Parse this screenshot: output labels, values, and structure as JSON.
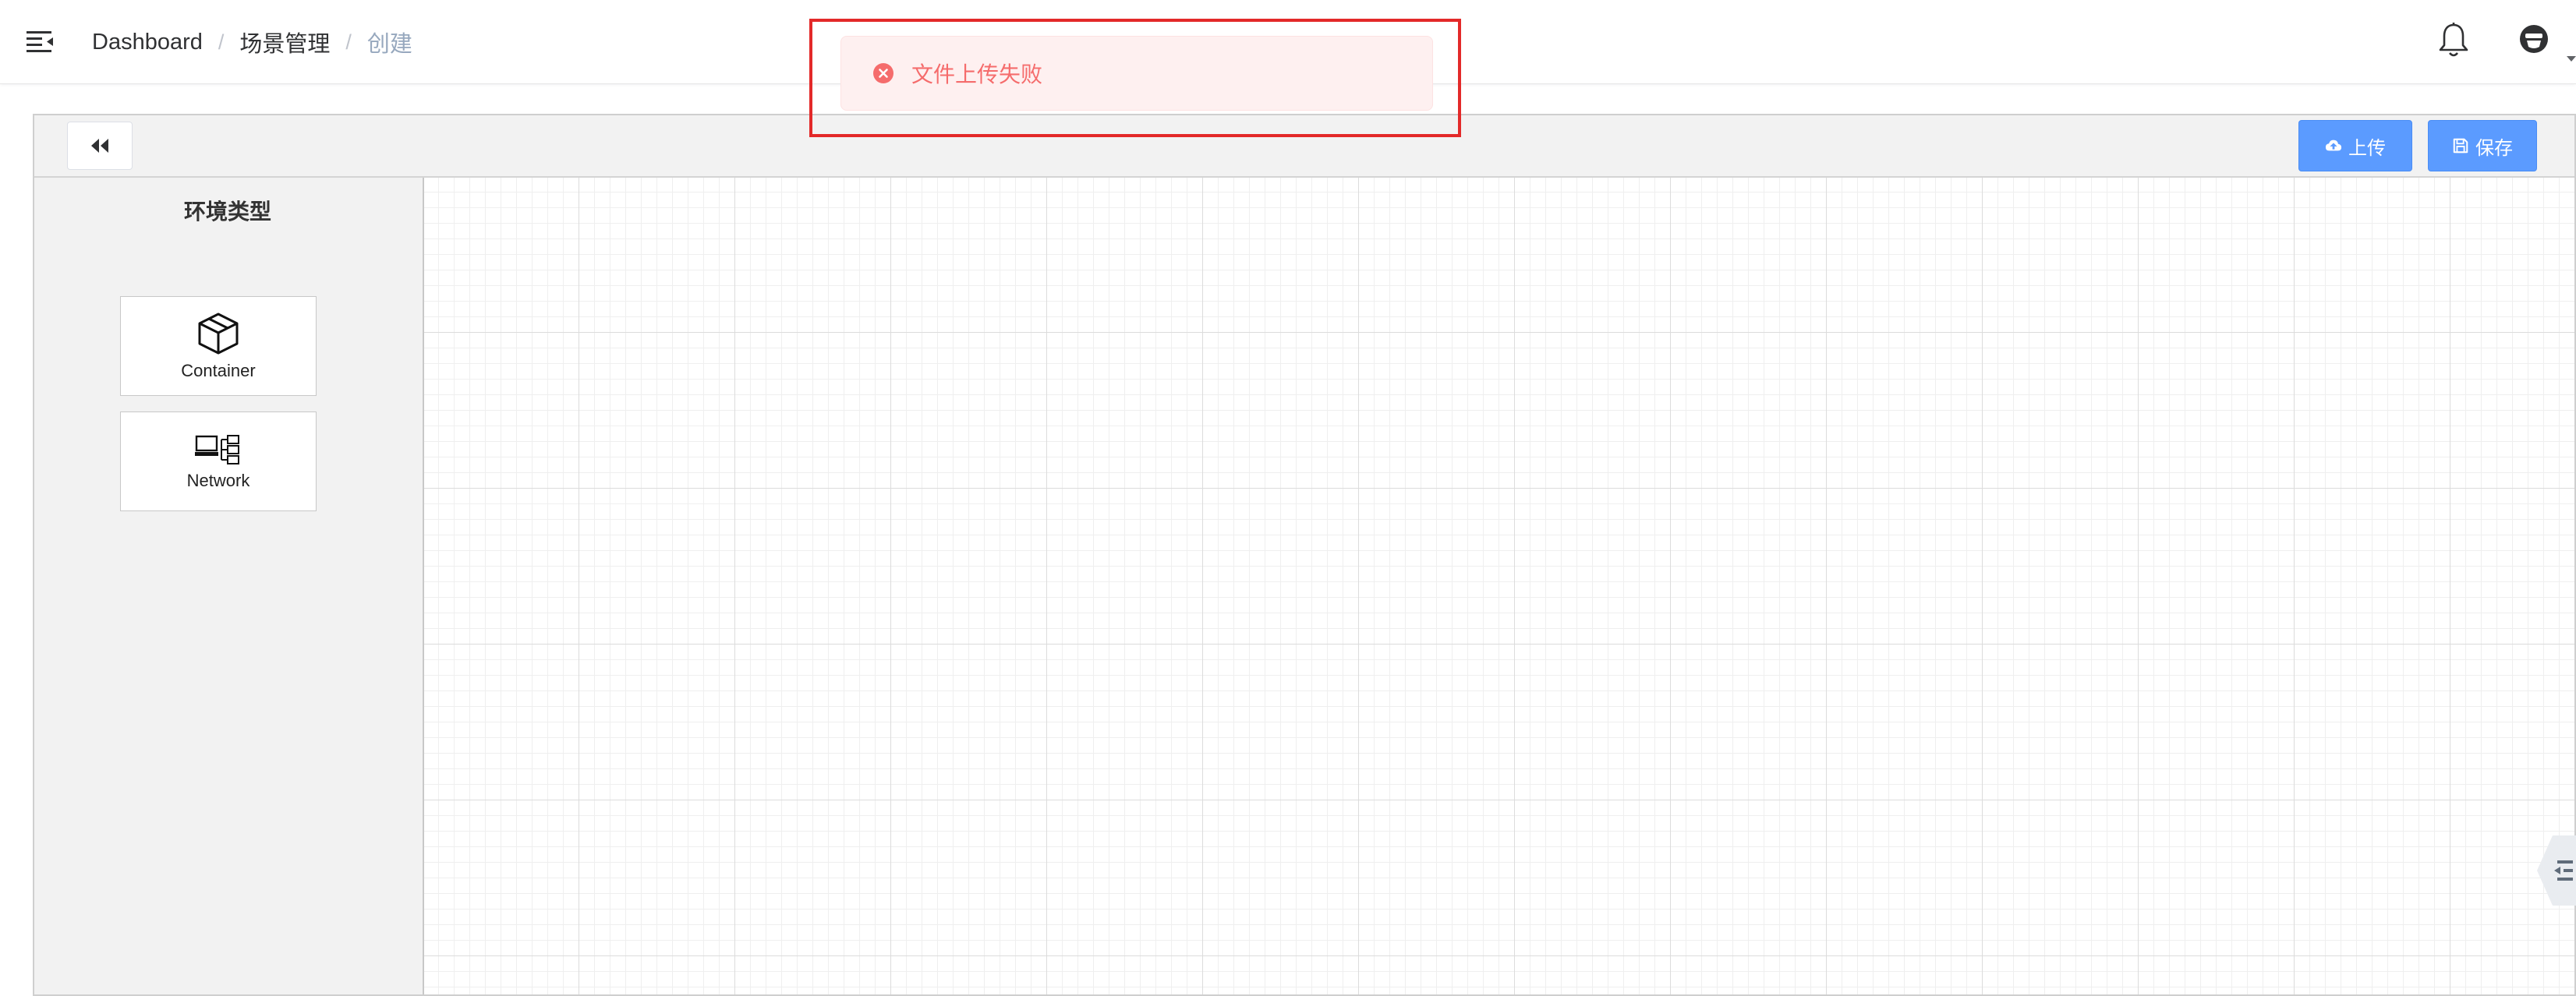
{
  "breadcrumb": {
    "items": [
      "Dashboard",
      "场景管理",
      "创建"
    ],
    "separator": "/"
  },
  "toast": {
    "type": "error",
    "message": "文件上传失败"
  },
  "toolbar": {
    "upload_label": "上传",
    "save_label": "保存"
  },
  "palette": {
    "title": "环境类型",
    "items": [
      {
        "label": "Container",
        "icon": "cube-icon"
      },
      {
        "label": "Network",
        "icon": "network-icon"
      }
    ]
  },
  "colors": {
    "primary": "#5b9bff",
    "error": "#f56c6c",
    "error_bg": "#fef0f0",
    "highlight": "#e32929"
  }
}
